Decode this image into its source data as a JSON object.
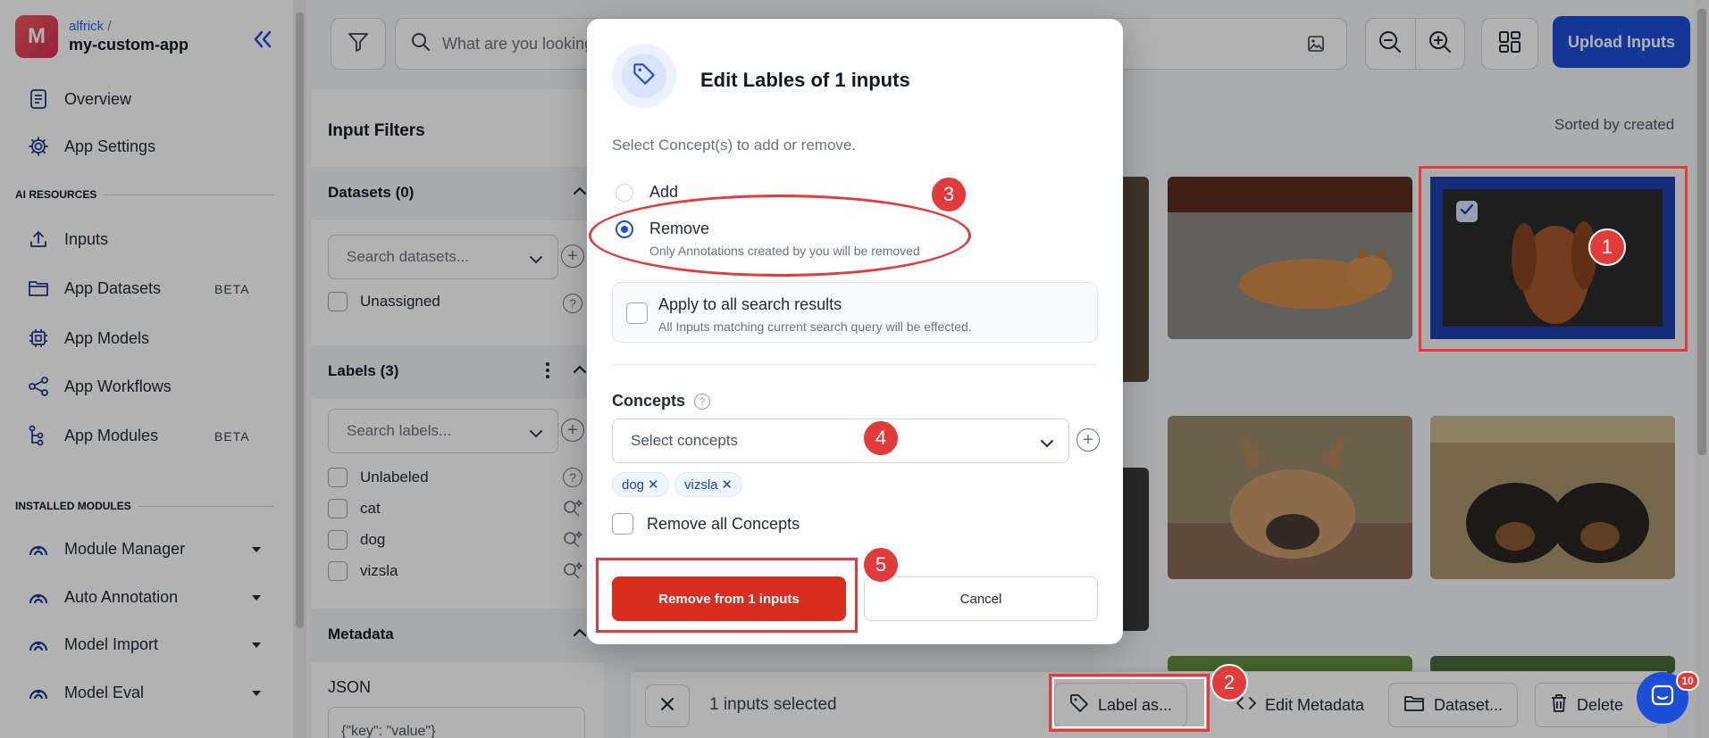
{
  "sidebar": {
    "avatar_letter": "M",
    "owner": "alfrick",
    "owner_sep": "/",
    "app_name": "my-custom-app",
    "nav_top": [
      {
        "label": "Overview",
        "icon": "document-icon"
      },
      {
        "label": "App Settings",
        "icon": "gear-icon"
      }
    ],
    "ai_resources_title": "AI RESOURCES",
    "ai_resources": [
      {
        "label": "Inputs",
        "icon": "upload-icon",
        "badge": ""
      },
      {
        "label": "App Datasets",
        "icon": "folder-icon",
        "badge": "BETA"
      },
      {
        "label": "App Models",
        "icon": "chip-icon",
        "badge": ""
      },
      {
        "label": "App Workflows",
        "icon": "share-icon",
        "badge": ""
      },
      {
        "label": "App Modules",
        "icon": "modules-icon",
        "badge": "BETA"
      }
    ],
    "installed_title": "INSTALLED MODULES",
    "installed": [
      {
        "label": "Module Manager"
      },
      {
        "label": "Auto Annotation"
      },
      {
        "label": "Model Import"
      },
      {
        "label": "Model Eval"
      }
    ]
  },
  "topbar": {
    "search_placeholder": "What are you looking",
    "upload_label": "Upload Inputs"
  },
  "filters": {
    "title": "Input Filters",
    "datasets_title": "Datasets (0)",
    "datasets_search": "Search datasets...",
    "unassigned": "Unassigned",
    "labels_title": "Labels (3)",
    "labels_search": "Search labels...",
    "labels": [
      "Unlabeled",
      "cat",
      "dog",
      "vizsla"
    ],
    "metadata_title": "Metadata",
    "json_label": "JSON",
    "json_placeholder": "{\"key\": \"value\"}"
  },
  "gallery": {
    "sorted_label": "Sorted by created"
  },
  "bottom_bar": {
    "selected_text": "1 inputs selected",
    "label_as": "Label as...",
    "edit_metadata": "Edit Metadata",
    "dataset": "Dataset...",
    "delete": "Delete"
  },
  "chat": {
    "count": "10"
  },
  "modal": {
    "title": "Edit Lables of 1 inputs",
    "subtitle": "Select Concept(s) to add or remove.",
    "add_label": "Add",
    "remove_label": "Remove",
    "remove_hint": "Only Annotations created by you will be removed",
    "selected_mode": "remove",
    "apply_label": "Apply to all search results",
    "apply_hint": "All Inputs matching current search query will be effected.",
    "concepts_label": "Concepts",
    "concepts_placeholder": "Select concepts",
    "tags": [
      "dog",
      "vizsla"
    ],
    "remove_all_label": "Remove all Concepts",
    "primary_label": "Remove from 1 inputs",
    "cancel_label": "Cancel"
  },
  "steps": [
    "1",
    "2",
    "3",
    "4",
    "5"
  ],
  "colors": {
    "brand_blue": "#1d4ed8",
    "danger_red": "#d92d20",
    "annotation_red": "#e23b3b"
  }
}
